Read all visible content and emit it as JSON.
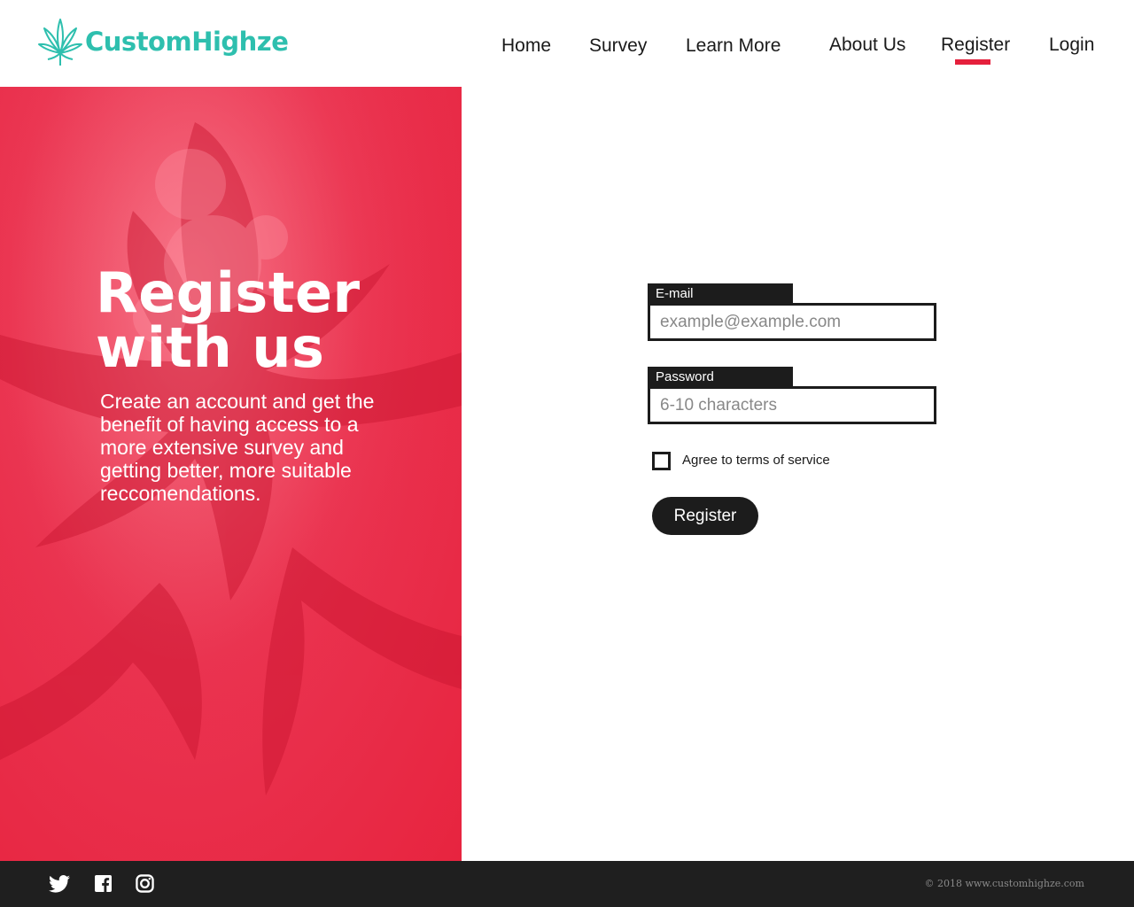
{
  "brand": {
    "name": "CustomHighze",
    "color": "#2ebfae",
    "logo_icon": "cannabis-leaf-icon"
  },
  "nav": {
    "items": [
      {
        "label": "Home",
        "active": false
      },
      {
        "label": "Survey",
        "active": false
      },
      {
        "label": "Learn More",
        "active": false
      },
      {
        "label": "About Us",
        "active": false
      },
      {
        "label": "Register",
        "active": true
      },
      {
        "label": "Login",
        "active": false
      }
    ],
    "active_indicator_color": "#e5203c"
  },
  "hero": {
    "title_line1": "Register",
    "title_line2": "with us",
    "description": "Create an account and get the benefit of having access to a more extensive survey and getting better, more suitable reccomendations.",
    "background_color": "#e7243f"
  },
  "form": {
    "email": {
      "label": "E-mail",
      "placeholder": "example@example.com",
      "value": ""
    },
    "password": {
      "label": "Password",
      "placeholder": "6-10 characters",
      "value": ""
    },
    "terms": {
      "label": "Agree to terms of service",
      "checked": false
    },
    "submit_label": "Register"
  },
  "footer": {
    "social_icons": [
      "twitter-icon",
      "facebook-icon",
      "instagram-icon"
    ],
    "copyright": "© 2018 www.customhighze.com"
  }
}
